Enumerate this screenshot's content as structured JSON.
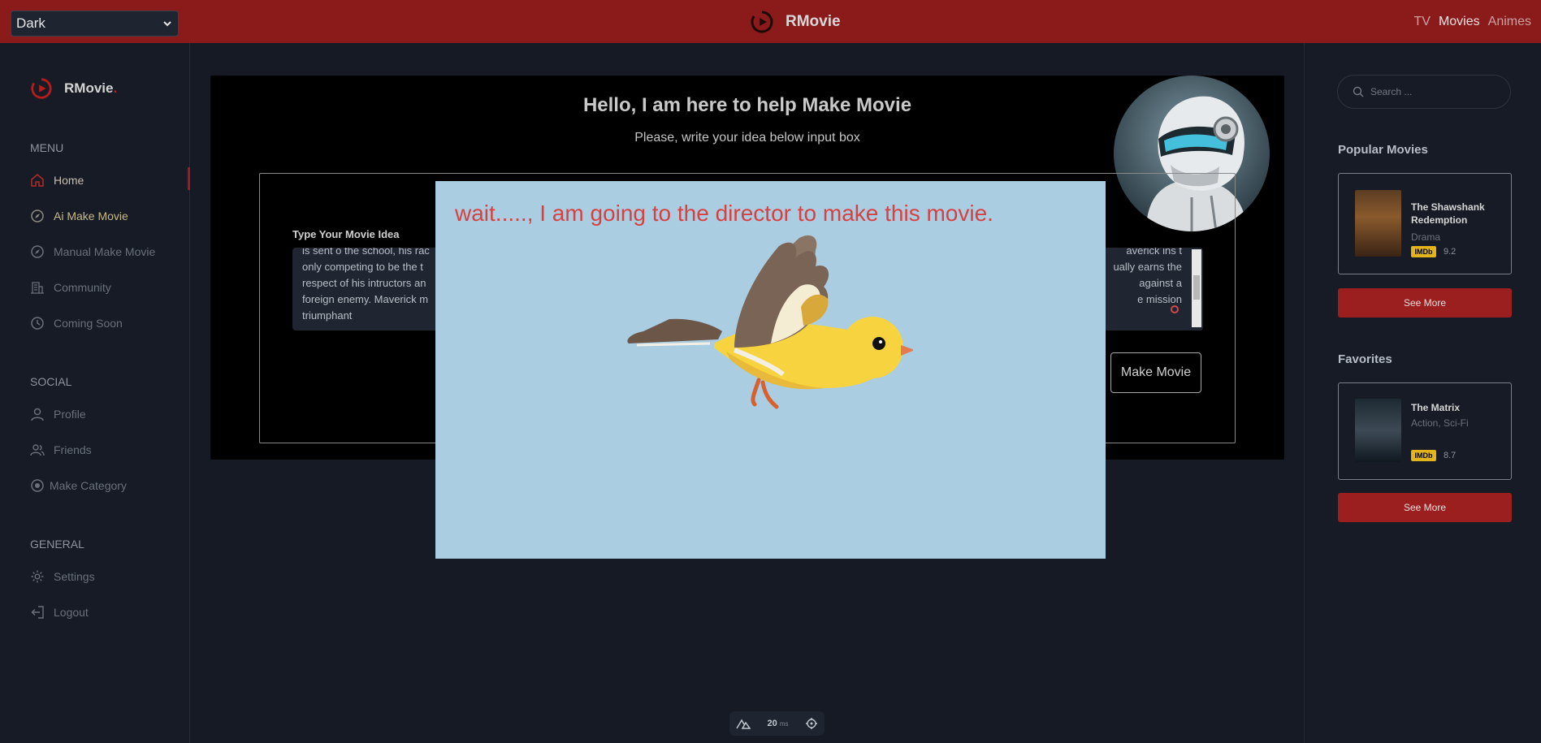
{
  "header": {
    "theme_value": "Dark",
    "brand": "RMovie",
    "nav": [
      "TV",
      "Movies",
      "Animes"
    ]
  },
  "sidebar": {
    "brand": "RMovie",
    "brand_dot": ".",
    "menu_title": "MENU",
    "menu": [
      "Home",
      "Ai Make Movie",
      "Manual Make Movie",
      "Community",
      "Coming Soon"
    ],
    "social_title": "SOCIAL",
    "social": [
      "Profile",
      "Friends",
      "Make Category"
    ],
    "general_title": "GENERAL",
    "general": [
      "Settings",
      "Logout"
    ]
  },
  "main": {
    "title": "Hello, I am here to help Make Movie",
    "subtitle": "Please, write your idea below input box",
    "idea_label": "Type Your Movie Idea",
    "idea_left_lines": [
      "is sent o the school, his rac",
      "only competing to be the t",
      "respect of his intructors an",
      "foreign enemy. Maverick m",
      "triumphant"
    ],
    "idea_right_lines": [
      "averick ins t",
      "ually earns the",
      "against a",
      "e mission"
    ],
    "make_button": "Make Movie"
  },
  "overlay": {
    "message": "wait....., I am going to the director to make this movie."
  },
  "rightbar": {
    "search_placeholder": "Search ...",
    "popular_title": "Popular Movies",
    "popular": {
      "title": "The Shawshank Redemption",
      "genre": "Drama",
      "imdb": "IMDb",
      "rating": "9.2"
    },
    "see_more_1": "See More",
    "favorites_title": "Favorites",
    "favorite": {
      "title": "The Matrix",
      "genre": "Action, Sci-Fi",
      "imdb": "IMDb",
      "rating": "8.7"
    },
    "see_more_2": "See More"
  },
  "perf": {
    "value": "20",
    "unit": "ms"
  },
  "colors": {
    "brand_red": "#8b1a1a",
    "button_red": "#9c1f1f",
    "overlay_bg": "#aacde2",
    "overlay_text": "#d94040",
    "imdb_yellow": "#e2b31b"
  }
}
